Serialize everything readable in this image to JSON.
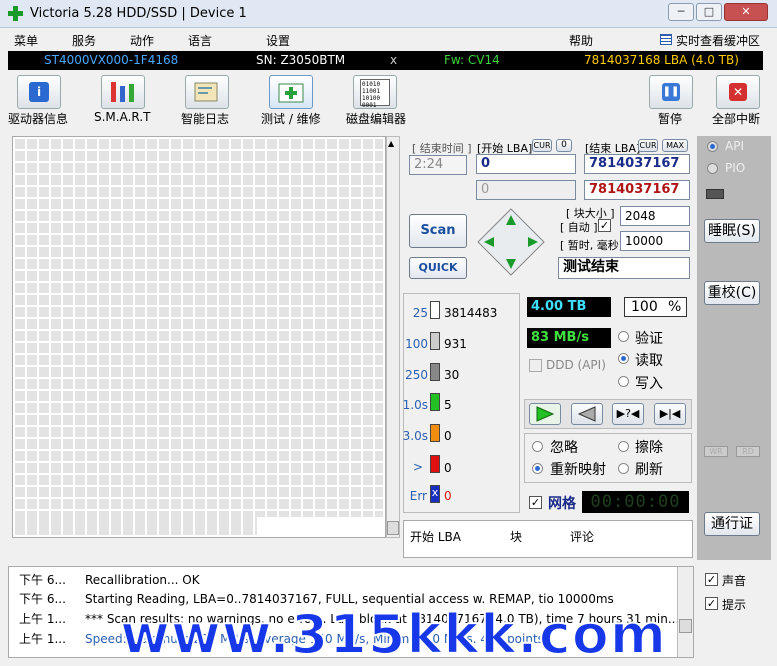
{
  "window": {
    "title": "Victoria 5.28 HDD/SSD | Device 1",
    "min": "─",
    "max": "□",
    "close": "✕"
  },
  "menu": [
    "菜单",
    "服务",
    "动作",
    "语言",
    "设置",
    "帮助"
  ],
  "menu_right": "实时查看缓冲区",
  "device": {
    "model": "ST4000VX000-1F4168",
    "serial": "SN: Z3050BTM",
    "close": "x",
    "fw": "Fw: CV14",
    "lba": "7814037168 LBA (4.0 TB)"
  },
  "toolbar": {
    "drive_info": "驱动器信息",
    "smart": "S.M.A.R.T",
    "smart_log": "智能日志",
    "test": "测试 / 维修",
    "disk_editor": "磁盘编辑器",
    "pause": "暂停",
    "abort": "全部中断"
  },
  "scan": {
    "end_time_lbl": "[ 结束时间 ]",
    "start_lba_lbl": "[开始 LBA]",
    "cur": "CUR",
    "zero": "0",
    "end_lba_lbl": "[结束 LBA]",
    "cur2": "CUR",
    "max": "MAX",
    "time": "2:24",
    "start_lba": "0",
    "end_lba": "7814037167",
    "start_lba2": "0",
    "end_lba2": "7814037167",
    "block_size_lbl": "[ 块大小 ]",
    "auto_lbl": "[ 自动 ]",
    "timeout_lbl": "[ 暂时, 毫秒]",
    "block_size": "2048",
    "timeout": "10000",
    "scan_btn": "Scan",
    "quick_btn": "QUICK",
    "status": "测试结束"
  },
  "stats": {
    "t25": "25",
    "v25": "3814483",
    "t100": "100",
    "v100": "931",
    "t250": "250",
    "v250": "30",
    "t1s": "1.0s",
    "v1s": "5",
    "t3s": "3.0s",
    "v3s": "0",
    "tgt": ">",
    "vgt": "0",
    "err": "Err",
    "verr": "0"
  },
  "progress": {
    "size": "4.00 TB",
    "percent": "100",
    "pct": "%",
    "speed": "83 MB/s",
    "ddd": "DDD (API)"
  },
  "modes": {
    "verify": "验证",
    "read": "读取",
    "write": "写入",
    "ignore": "忽略",
    "erase": "擦除",
    "remap": "重新映射",
    "refresh": "刷新"
  },
  "bottom": {
    "grid": "网格",
    "timer": "00:00:00",
    "col_lba": "开始 LBA",
    "col_block": "块",
    "col_comment": "评论"
  },
  "right": {
    "api": "API",
    "pio": "PIO",
    "sleep": "睡眠(S)",
    "recal": "重校(C)",
    "wr": "WR",
    "rd": "RD",
    "comm": "通行证",
    "sound": "声音",
    "hints": "提示"
  },
  "log": [
    {
      "t": "下午 6...",
      "m": "Recallibration... OK"
    },
    {
      "t": "下午 6...",
      "m": "Starting Reading, LBA=0..7814037167, FULL, sequential access w. REMAP, tio 10000ms"
    },
    {
      "t": "上午 1...",
      "m": "*** Scan results: no warnings, no errors. Last block at 7814037167 (4.0 TB), time 7 hours 31 min..."
    },
    {
      "t": "上午 1...",
      "m": "Speed: Maximum 222 MB/s, Average 140 MB/s, Minimum 0 MB/s. 423 points."
    }
  ],
  "watermark": "www.315kkk.com",
  "colors": {
    "accent": "#2a5fb0",
    "green": "#22c022",
    "orange": "#f08c10",
    "red": "#e01010"
  }
}
